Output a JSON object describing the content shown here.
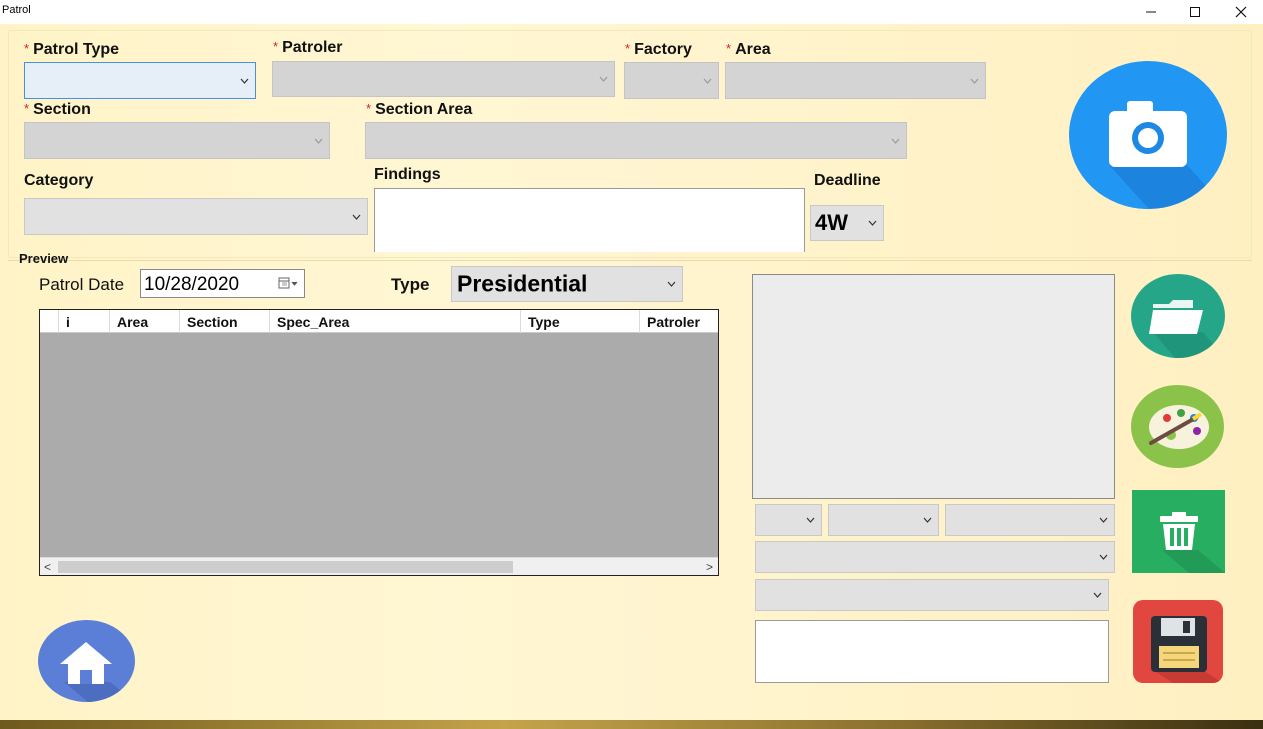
{
  "window": {
    "title": "Patrol",
    "minimize_glyph": "—",
    "maximize_glyph": "☐",
    "close_glyph": "✕"
  },
  "form": {
    "required_mark": "*",
    "patrol_type_label": "Patrol Type",
    "patroler_label": "Patroler",
    "factory_label": "Factory",
    "area_label": "Area",
    "section_label": "Section",
    "section_area_label": "Section Area",
    "category_label": "Category",
    "findings_label": "Findings",
    "deadline_label": "Deadline",
    "deadline_value": "4W"
  },
  "preview": {
    "group_label": "Preview",
    "patrol_date_label": "Patrol Date",
    "patrol_date_value": "10/28/2020",
    "type_label": "Type",
    "type_value": "Presidential"
  },
  "grid": {
    "columns": [
      "i",
      "Area",
      "Section",
      "Spec_Area",
      "Type",
      "Patroler"
    ],
    "scroll_left": "<",
    "scroll_right": ">"
  },
  "icons": {
    "camera": "camera-icon",
    "folder": "folder-open-icon",
    "palette": "paint-palette-icon",
    "trash": "trash-icon",
    "save": "floppy-disk-icon",
    "home": "home-icon"
  },
  "colors": {
    "background": "#fff3c7",
    "camera_button": "#2196f3",
    "folder_button": "#26a689",
    "palette_button": "#8bc34a",
    "trash_button": "#27ae60",
    "save_button": "#e2473f",
    "home_button": "#5b7fd6"
  }
}
